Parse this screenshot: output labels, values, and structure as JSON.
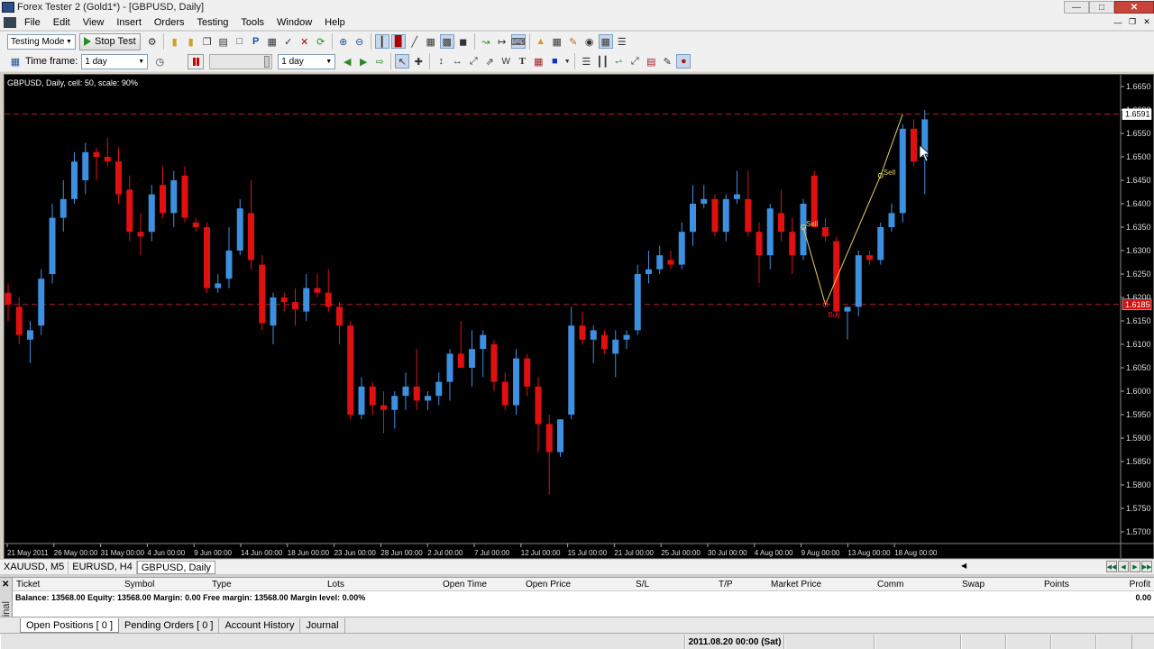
{
  "window": {
    "title": "Forex Tester 2  (Gold1*) - [GBPUSD, Daily]"
  },
  "menu": [
    "File",
    "Edit",
    "View",
    "Insert",
    "Orders",
    "Testing",
    "Tools",
    "Window",
    "Help"
  ],
  "toolbar": {
    "mode_value": "Testing Mode",
    "stop_test_label": "Stop Test",
    "timeframe_label": "Time frame:",
    "timeframe_value": "1 day",
    "speed_timeframe_value": "1 day"
  },
  "chart": {
    "label": "GBPUSD, Daily, cell: 50, scale: 90%",
    "current_price_label": "1.6591",
    "support_price_label": "1.6185",
    "signal_labels": [
      "Sell",
      "Sell",
      "Buy"
    ],
    "colors": {
      "background": "#000000",
      "bull": "#3d8fe0",
      "bear": "#e01010",
      "hline": "#b02020",
      "zigzag": "#e8d060"
    }
  },
  "chart_data": {
    "type": "candlestick",
    "ylim": [
      1.5675,
      1.6675
    ],
    "y_ticks": [
      "1.6650",
      "1.6600",
      "1.6550",
      "1.6500",
      "1.6450",
      "1.6400",
      "1.6350",
      "1.6300",
      "1.6250",
      "1.6200",
      "1.6150",
      "1.6100",
      "1.6050",
      "1.6000",
      "1.5950",
      "1.5900",
      "1.5850",
      "1.5800",
      "1.5750",
      "1.5700"
    ],
    "x_ticks": [
      "21 May 2011",
      "26 May 00:00",
      "31 May 00:00",
      "4 Jun 00:00",
      "9 Jun 00:00",
      "14 Jun 00:00",
      "18 Jun 00:00",
      "23 Jun 00:00",
      "28 Jun 00:00",
      "2 Jul 00:00",
      "7 Jul 00:00",
      "12 Jul 00:00",
      "15 Jul 00:00",
      "21 Jul 00:00",
      "25 Jul 00:00",
      "30 Jul 00:00",
      "4 Aug 00:00",
      "9 Aug 00:00",
      "13 Aug 00:00",
      "18 Aug 00:00"
    ],
    "hlines": [
      1.6591,
      1.6185
    ],
    "candles": [
      [
        1.621,
        1.623,
        1.615,
        1.6185
      ],
      [
        1.618,
        1.62,
        1.61,
        1.612
      ],
      [
        1.611,
        1.615,
        1.606,
        1.613
      ],
      [
        1.614,
        1.626,
        1.612,
        1.624
      ],
      [
        1.625,
        1.64,
        1.623,
        1.637
      ],
      [
        1.637,
        1.645,
        1.634,
        1.641
      ],
      [
        1.641,
        1.651,
        1.64,
        1.649
      ],
      [
        1.645,
        1.653,
        1.642,
        1.651
      ],
      [
        1.651,
        1.652,
        1.645,
        1.65
      ],
      [
        1.65,
        1.654,
        1.648,
        1.649
      ],
      [
        1.649,
        1.652,
        1.64,
        1.642
      ],
      [
        1.643,
        1.646,
        1.632,
        1.634
      ],
      [
        1.634,
        1.638,
        1.629,
        1.633
      ],
      [
        1.634,
        1.644,
        1.632,
        1.642
      ],
      [
        1.644,
        1.648,
        1.637,
        1.638
      ],
      [
        1.638,
        1.647,
        1.635,
        1.645
      ],
      [
        1.646,
        1.648,
        1.636,
        1.637
      ],
      [
        1.636,
        1.637,
        1.634,
        1.635
      ],
      [
        1.635,
        1.636,
        1.621,
        1.622
      ],
      [
        1.622,
        1.625,
        1.621,
        1.623
      ],
      [
        1.624,
        1.635,
        1.622,
        1.63
      ],
      [
        1.63,
        1.641,
        1.629,
        1.639
      ],
      [
        1.638,
        1.645,
        1.626,
        1.628
      ],
      [
        1.627,
        1.629,
        1.613,
        1.6145
      ],
      [
        1.614,
        1.621,
        1.61,
        1.62
      ],
      [
        1.62,
        1.621,
        1.617,
        1.619
      ],
      [
        1.619,
        1.622,
        1.614,
        1.6175
      ],
      [
        1.617,
        1.625,
        1.615,
        1.622
      ],
      [
        1.622,
        1.625,
        1.62,
        1.621
      ],
      [
        1.621,
        1.626,
        1.617,
        1.618
      ],
      [
        1.618,
        1.619,
        1.61,
        1.614
      ],
      [
        1.614,
        1.615,
        1.594,
        1.595
      ],
      [
        1.595,
        1.603,
        1.594,
        1.601
      ],
      [
        1.601,
        1.602,
        1.595,
        1.597
      ],
      [
        1.597,
        1.6,
        1.591,
        1.596
      ],
      [
        1.596,
        1.6,
        1.592,
        1.599
      ],
      [
        1.599,
        1.604,
        1.596,
        1.601
      ],
      [
        1.601,
        1.609,
        1.596,
        1.598
      ],
      [
        1.598,
        1.6,
        1.596,
        1.599
      ],
      [
        1.599,
        1.604,
        1.597,
        1.602
      ],
      [
        1.602,
        1.609,
        1.598,
        1.608
      ],
      [
        1.608,
        1.615,
        1.606,
        1.605
      ],
      [
        1.605,
        1.613,
        1.601,
        1.609
      ],
      [
        1.609,
        1.613,
        1.603,
        1.612
      ],
      [
        1.61,
        1.611,
        1.6,
        1.602
      ],
      [
        1.602,
        1.604,
        1.596,
        1.597
      ],
      [
        1.597,
        1.609,
        1.595,
        1.607
      ],
      [
        1.607,
        1.608,
        1.599,
        1.601
      ],
      [
        1.601,
        1.603,
        1.587,
        1.593
      ],
      [
        1.593,
        1.595,
        1.578,
        1.587
      ],
      [
        1.587,
        1.594,
        1.586,
        1.594
      ],
      [
        1.595,
        1.618,
        1.594,
        1.614
      ],
      [
        1.614,
        1.617,
        1.61,
        1.611
      ],
      [
        1.611,
        1.614,
        1.606,
        1.613
      ],
      [
        1.612,
        1.613,
        1.608,
        1.609
      ],
      [
        1.608,
        1.613,
        1.603,
        1.611
      ],
      [
        1.611,
        1.613,
        1.609,
        1.612
      ],
      [
        1.613,
        1.627,
        1.612,
        1.625
      ],
      [
        1.625,
        1.63,
        1.623,
        1.626
      ],
      [
        1.626,
        1.631,
        1.625,
        1.629
      ],
      [
        1.628,
        1.63,
        1.626,
        1.627
      ],
      [
        1.627,
        1.636,
        1.626,
        1.634
      ],
      [
        1.634,
        1.644,
        1.631,
        1.64
      ],
      [
        1.64,
        1.644,
        1.639,
        1.641
      ],
      [
        1.641,
        1.642,
        1.633,
        1.634
      ],
      [
        1.634,
        1.642,
        1.632,
        1.641
      ],
      [
        1.641,
        1.647,
        1.64,
        1.642
      ],
      [
        1.641,
        1.647,
        1.633,
        1.634
      ],
      [
        1.634,
        1.636,
        1.623,
        1.629
      ],
      [
        1.629,
        1.64,
        1.626,
        1.639
      ],
      [
        1.638,
        1.643,
        1.632,
        1.634
      ],
      [
        1.634,
        1.637,
        1.625,
        1.629
      ],
      [
        1.629,
        1.641,
        1.628,
        1.64
      ],
      [
        1.646,
        1.647,
        1.635,
        1.635
      ],
      [
        1.635,
        1.637,
        1.632,
        1.633
      ],
      [
        1.632,
        1.633,
        1.616,
        1.617
      ],
      [
        1.617,
        1.618,
        1.611,
        1.618
      ],
      [
        1.618,
        1.63,
        1.616,
        1.629
      ],
      [
        1.629,
        1.63,
        1.627,
        1.628
      ],
      [
        1.628,
        1.636,
        1.627,
        1.635
      ],
      [
        1.635,
        1.64,
        1.634,
        1.638
      ],
      [
        1.638,
        1.657,
        1.636,
        1.656
      ],
      [
        1.656,
        1.658,
        1.648,
        1.649
      ],
      [
        1.65,
        1.66,
        1.642,
        1.658
      ]
    ],
    "zigzag": [
      [
        72,
        1.635
      ],
      [
        74,
        1.6185
      ],
      [
        79,
        1.646
      ],
      [
        81,
        1.6591
      ]
    ]
  },
  "chart_tabs": [
    "XAUUSD, M5",
    "EURUSD, H4",
    "GBPUSD, Daily"
  ],
  "terminal": {
    "side_label": "Terminal",
    "columns": [
      "Ticket",
      "Symbol",
      "Type",
      "Lots",
      "Open Time",
      "Open Price",
      "S/L",
      "T/P",
      "Market Price",
      "Comm",
      "Swap",
      "Points",
      "Profit"
    ],
    "balance_line": "Balance: 13568.00 Equity: 13568.00 Margin: 0.00 Free margin: 13568.00 Margin level: 0.00%",
    "profit_total": "0.00",
    "tabs": [
      "Open Positions  [ 0 ]",
      "Pending Orders  [ 0 ]",
      "Account History",
      "Journal"
    ]
  },
  "status": {
    "datetime": "2011.08.20 00:00 (Sat)"
  }
}
